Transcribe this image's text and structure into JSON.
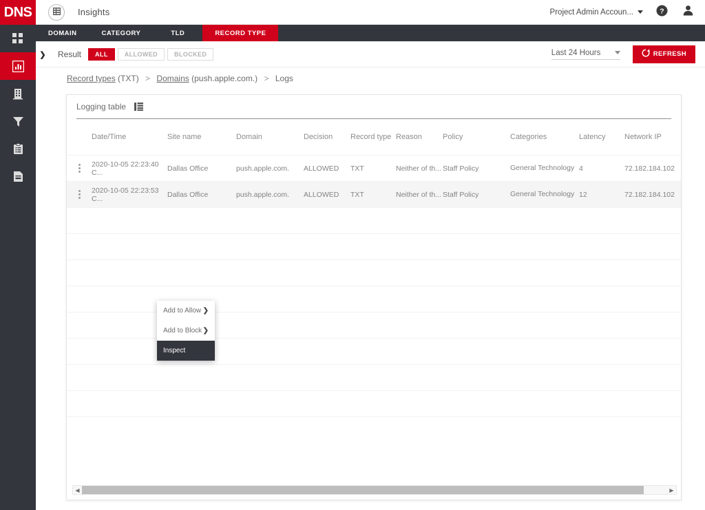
{
  "brand": {
    "logo_text": "DNS",
    "accent": "#d0021b",
    "dark": "#33363d"
  },
  "rail": {
    "items": [
      {
        "name": "dashboard",
        "icon": "grid-icon",
        "active": false
      },
      {
        "name": "insights",
        "icon": "bar-chart-icon",
        "active": true
      },
      {
        "name": "sites",
        "icon": "building-icon",
        "active": false
      },
      {
        "name": "filters",
        "icon": "funnel-icon",
        "active": false
      },
      {
        "name": "policies",
        "icon": "clipboard-icon",
        "active": false
      },
      {
        "name": "reports",
        "icon": "document-icon",
        "active": false
      }
    ]
  },
  "header": {
    "grid_icon": "app-grid-icon",
    "title": "Insights",
    "account": "Project Admin Accoun...",
    "help_icon": "help-icon",
    "user_icon": "user-icon"
  },
  "tabs": [
    {
      "label": "DOMAIN",
      "active": false
    },
    {
      "label": "CATEGORY",
      "active": false
    },
    {
      "label": "TLD",
      "active": false
    },
    {
      "label": "RECORD TYPE",
      "active": true
    }
  ],
  "filter_bar": {
    "expand_icon": "chevron-right-icon",
    "result_label": "Result",
    "segments": [
      {
        "label": "ALL",
        "active": true
      },
      {
        "label": "ALLOWED",
        "active": false
      },
      {
        "label": "BLOCKED",
        "active": false
      }
    ],
    "range_value": "Last 24 Hours",
    "refresh_label": "REFRESH",
    "refresh_icon": "refresh-icon"
  },
  "breadcrumb": {
    "part1_link": "Record types",
    "part1_value": "(TXT)",
    "sep": ">",
    "part2_link": "Domains",
    "part2_value": "(push.apple.com.)",
    "part3": "Logs"
  },
  "card": {
    "title": "Logging table",
    "title_icon": "table-columns-icon"
  },
  "table": {
    "columns": [
      "Date/Time",
      "Site name",
      "Domain",
      "Decision",
      "Record type",
      "Reason",
      "Policy",
      "Categories",
      "Latency",
      "Network IP"
    ],
    "rows": [
      {
        "date": "2020-10-05 22:23:40 C...",
        "site": "Dallas Office",
        "domain": "push.apple.com.",
        "decision": "ALLOWED",
        "record_type": "TXT",
        "reason": "Neither of th...",
        "policy": "Staff Policy",
        "categories": "General Technology",
        "latency": "4",
        "ip": "72.182.184.102",
        "hover": false
      },
      {
        "date": "2020-10-05 22:23:53 C...",
        "site": "Dallas Office",
        "domain": "push.apple.com.",
        "decision": "ALLOWED",
        "record_type": "TXT",
        "reason": "Neither of th...",
        "policy": "Staff Policy",
        "categories": "General Technology",
        "latency": "12",
        "ip": "72.182.184.102",
        "hover": true
      }
    ],
    "empty_row_count": 9
  },
  "context_menu": {
    "items": [
      {
        "label": "Add to Allow",
        "has_submenu": true,
        "selected": false
      },
      {
        "label": "Add to Block",
        "has_submenu": true,
        "selected": false
      },
      {
        "label": "Inspect",
        "has_submenu": false,
        "selected": true
      }
    ],
    "submenu_chevron": "›"
  },
  "scrollbar": {
    "left_arrow": "◀",
    "right_arrow": "▶"
  }
}
